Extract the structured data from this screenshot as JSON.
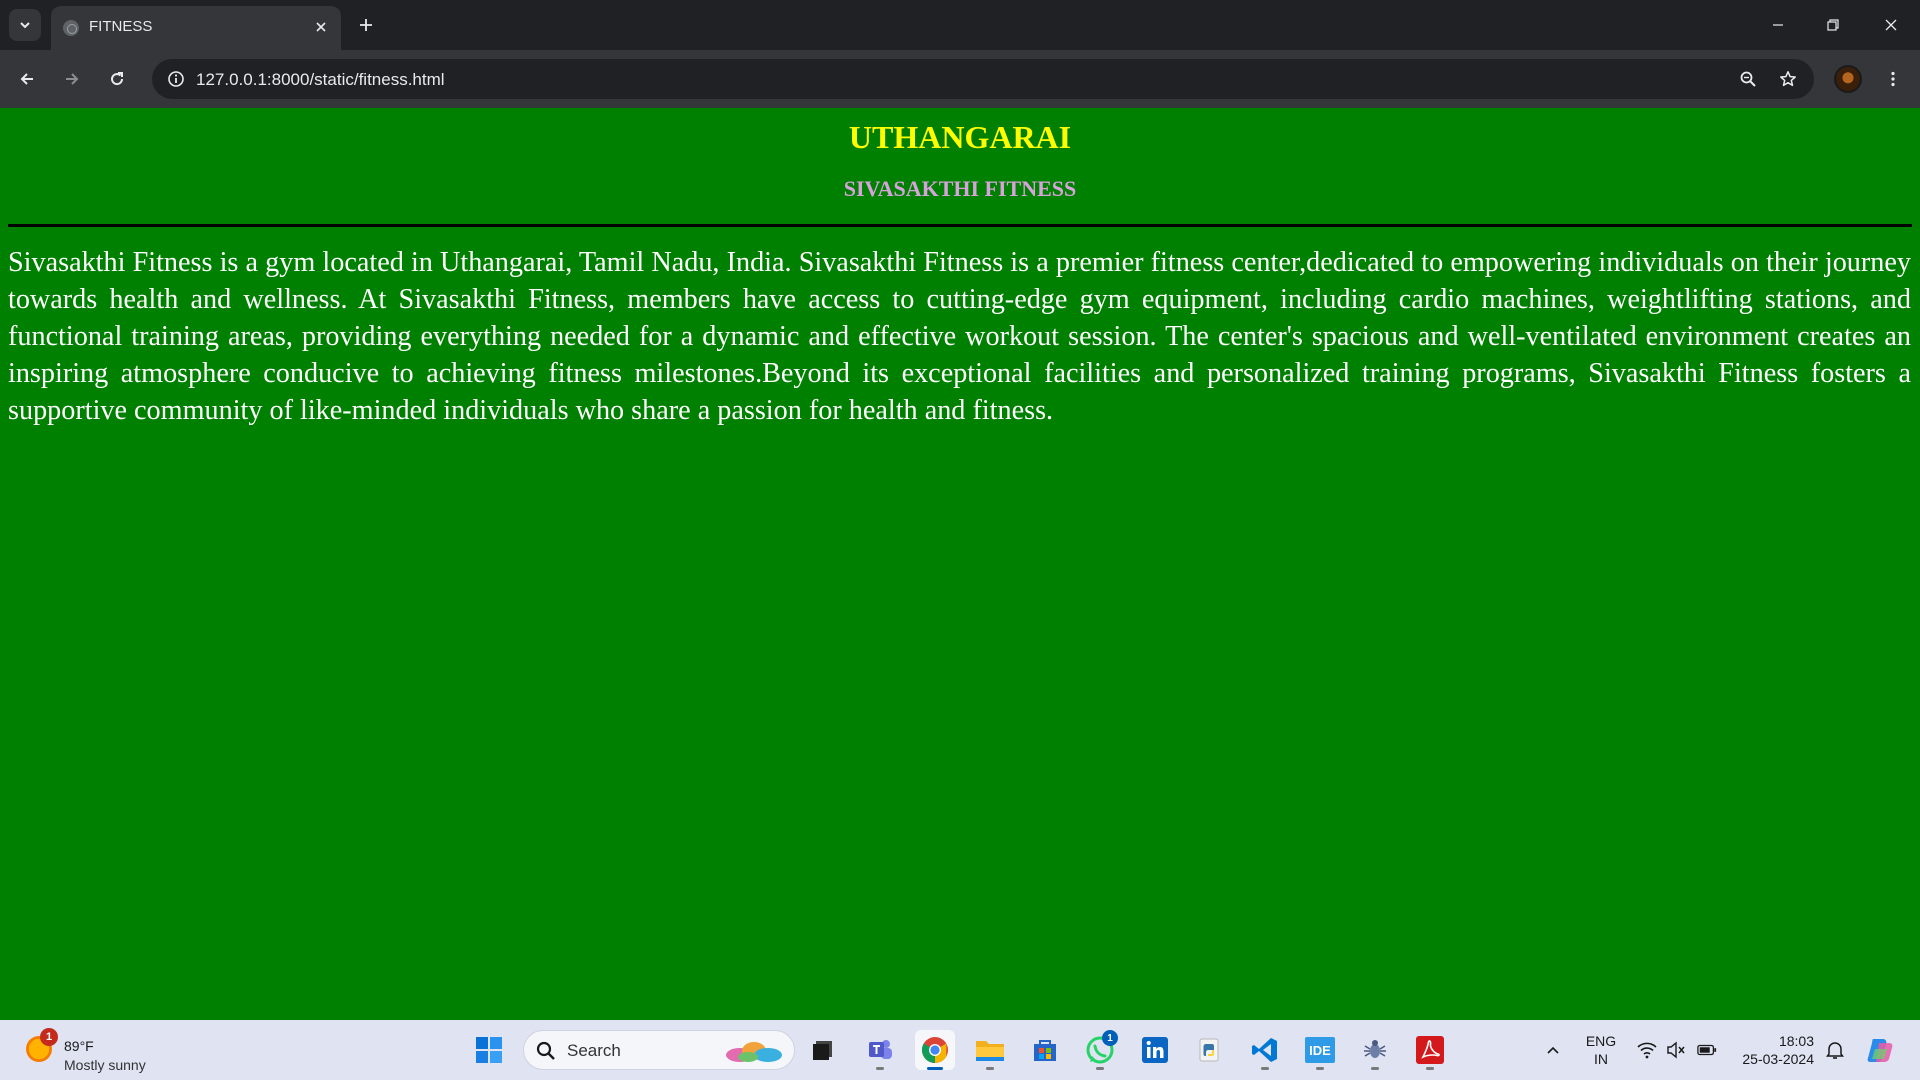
{
  "browser": {
    "tab": {
      "title": "FITNESS"
    },
    "address_bar": {
      "url": "127.0.0.1:8000/static/fitness.html"
    }
  },
  "page": {
    "heading": "UTHANGARAI",
    "subheading": "SIVASAKTHI FITNESS",
    "paragraph": "Sivasakthi Fitness is a gym located in Uthangarai, Tamil Nadu, India. Sivasakthi Fitness is a premier fitness center,dedicated to empowering individuals on their journey towards health and wellness. At Sivasakthi Fitness, members have access to cutting-edge gym equipment, including cardio machines, weightlifting stations, and functional training areas, providing everything needed for a dynamic and effective workout session. The center's spacious and well-ventilated environment creates an inspiring atmosphere conducive to achieving fitness milestones.Beyond its exceptional facilities and personalized training programs, Sivasakthi Fitness fosters a supportive community of like-minded individuals who share a passion for health and fitness.",
    "colors": {
      "background": "#008000",
      "heading": "#ffff00",
      "subheading": "#d8a3dc",
      "text": "#ffffff"
    }
  },
  "taskbar": {
    "weather": {
      "temp": "89°F",
      "condition": "Mostly sunny",
      "badge": "1"
    },
    "search": {
      "label": "Search"
    },
    "apps": [
      {
        "name": "start-icon"
      },
      {
        "name": "task-view-icon"
      },
      {
        "name": "teams-icon"
      },
      {
        "name": "chrome-icon"
      },
      {
        "name": "file-explorer-icon"
      },
      {
        "name": "microsoft-store-icon"
      },
      {
        "name": "whatsapp-icon",
        "badge": "1"
      },
      {
        "name": "linkedin-icon"
      },
      {
        "name": "python-icon"
      },
      {
        "name": "vscode-icon"
      },
      {
        "name": "ide-icon",
        "label": "IDE"
      },
      {
        "name": "app-icon"
      },
      {
        "name": "acrobat-icon"
      }
    ],
    "tray": {
      "lang_line1": "ENG",
      "lang_line2": "IN",
      "time": "18:03",
      "date": "25-03-2024"
    }
  }
}
